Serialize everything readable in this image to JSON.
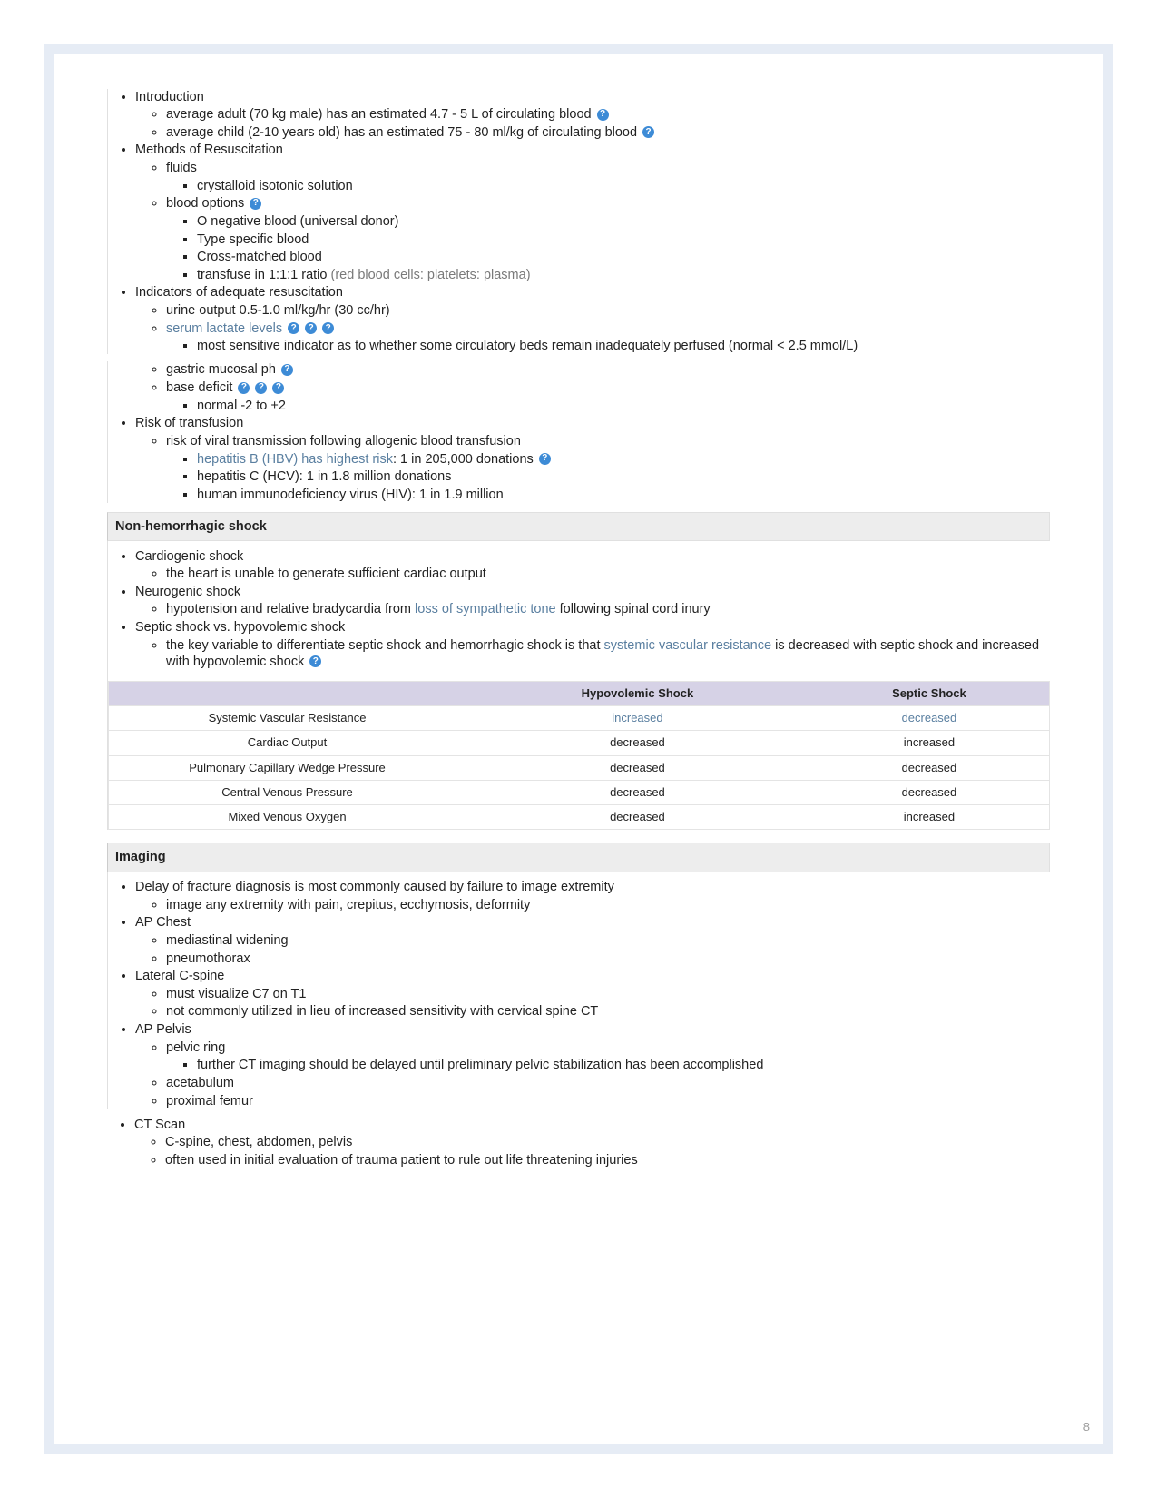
{
  "pageNumber": "8",
  "resus": {
    "intro": {
      "heading": "Introduction",
      "adult": "average adult (70 kg male) has an estimated 4.7 - 5 L of circulating blood",
      "child": "average child (2-10 years old) has an estimated 75 - 80 ml/kg of circulating blood"
    },
    "methods": {
      "heading": "Methods of Resuscitation",
      "fluids": "fluids",
      "crystalloid": "crystalloid isotonic solution",
      "bloodOptions": "blood options",
      "oNeg": "O negative blood (universal donor)",
      "typeSpecific": "Type specific blood",
      "crossMatched": "Cross-matched blood",
      "transfuse": "transfuse in 1:1:1 ratio ",
      "transfuseNote": "(red blood cells: platelets: plasma)"
    },
    "indicators": {
      "heading": "Indicators of adequate resuscitation",
      "urine": "urine output 0.5-1.0 ml/kg/hr (30 cc/hr)",
      "lactate": "serum lactate levels",
      "lactateDetail": "most sensitive indicator as to whether some circulatory beds remain inadequately perfused (normal < 2.5 mmol/L)",
      "gastric": "gastric mucosal ph",
      "baseDeficit": "base deficit",
      "baseDeficitNormal": "normal -2 to +2"
    },
    "risk": {
      "heading": "Risk of transfusion",
      "viral": "risk of viral transmission following allogenic blood transfusion",
      "hbvLink": "hepatitis B (HBV) has highest risk",
      "hbvRest": ": 1 in 205,000 donations",
      "hcv": "hepatitis C (HCV): 1 in 1.8 million donations",
      "hiv": "human immunodeficiency virus (HIV): 1 in 1.9 million"
    }
  },
  "nonHemo": {
    "header": "Non-hemorrhagic shock",
    "cardio": {
      "heading": "Cardiogenic shock",
      "detail": "the heart is unable to generate sufficient cardiac output"
    },
    "neuro": {
      "heading": "Neurogenic shock",
      "before": "hypotension and relative bradycardia from ",
      "link": "loss of sympathetic tone",
      "after": " following spinal cord inury"
    },
    "septic": {
      "heading": "Septic shock vs. hypovolemic shock",
      "before": "the key variable to differentiate septic shock and hemorrhagic shock is that ",
      "link": "systemic vascular resistance",
      "after": " is decreased with septic shock and increased with hypovolemic shock"
    }
  },
  "table": {
    "colHypo": "Hypovolemic Shock",
    "colSeptic": "Septic Shock",
    "rows": [
      {
        "label": "Systemic Vascular Resistance",
        "hypo": "increased",
        "septic": "decreased",
        "link": true
      },
      {
        "label": "Cardiac Output",
        "hypo": "decreased",
        "septic": "increased"
      },
      {
        "label": "Pulmonary Capillary Wedge Pressure",
        "hypo": "decreased",
        "septic": "decreased"
      },
      {
        "label": "Central Venous Pressure",
        "hypo": "decreased",
        "septic": "decreased"
      },
      {
        "label": "Mixed Venous Oxygen",
        "hypo": "decreased",
        "septic": "increased"
      }
    ]
  },
  "imaging": {
    "header": "Imaging",
    "delay": {
      "heading": "Delay of fracture diagnosis is most commonly caused by failure to image extremity",
      "sub": "image any extremity with pain, crepitus, ecchymosis, deformity"
    },
    "apChest": {
      "heading": "AP Chest",
      "a": "mediastinal widening",
      "b": "pneumothorax"
    },
    "lateralC": {
      "heading": "Lateral C-spine",
      "a": "must visualize C7 on T1",
      "b": "not commonly utilized in lieu of increased sensitivity with cervical spine CT"
    },
    "apPelvis": {
      "heading": "AP Pelvis",
      "ring": "pelvic ring",
      "ringDetail": "further CT imaging should be delayed until preliminary pelvic stabilization has been accomplished",
      "acetabulum": "acetabulum",
      "femur": "proximal femur"
    },
    "ct": {
      "heading": "CT Scan",
      "a": "C-spine, chest, abdomen, pelvis",
      "b": "often used in initial evaluation of trauma patient to rule out life threatening injuries"
    }
  },
  "questionMark": "?"
}
